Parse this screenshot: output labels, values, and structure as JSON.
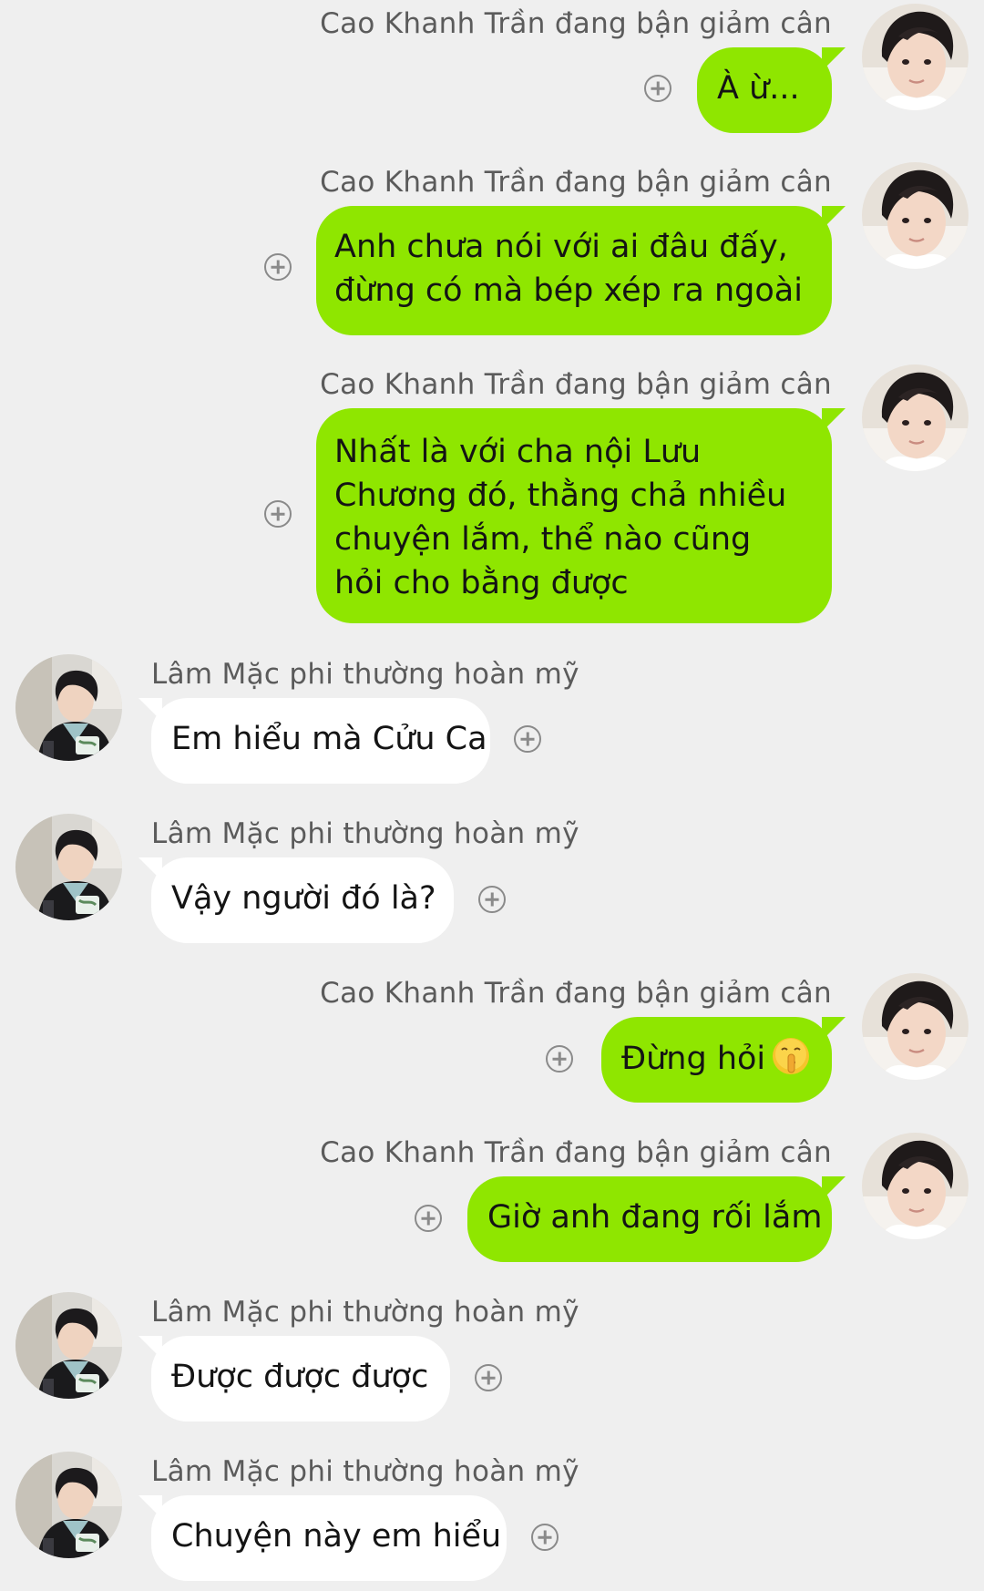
{
  "colors": {
    "background": "#efefef",
    "outgoing_bubble": "#8fe600",
    "incoming_bubble": "#ffffff",
    "name_text": "#5b5b5b",
    "plus_icon": "#8a8a8a"
  },
  "contacts": {
    "me_name": "Cao Khanh Trần đang bận giảm cân",
    "other_name": "Lâm Mặc phi thường hoàn mỹ"
  },
  "messages": [
    {
      "direction": "out",
      "text": "À ừ..."
    },
    {
      "direction": "out",
      "text": "Anh chưa nói với ai đâu đấy, đừng có mà bép xép ra ngoài"
    },
    {
      "direction": "out",
      "text": "Nhất là với cha nội Lưu Chương đó, thằng chả nhiều chuyện lắm, thể nào cũng hỏi cho bằng được"
    },
    {
      "direction": "in",
      "text": "Em hiểu mà Cửu Ca"
    },
    {
      "direction": "in",
      "text": "Vậy người đó là?"
    },
    {
      "direction": "out",
      "text": "Đừng hỏi",
      "emoji": "shushing-face-emoji"
    },
    {
      "direction": "out",
      "text": "Giờ anh đang rối lắm"
    },
    {
      "direction": "in",
      "text": "Được được được"
    },
    {
      "direction": "in",
      "text": "Chuyện này em hiểu"
    }
  ],
  "icons": {
    "add_reaction": "plus-circle-icon",
    "avatar_me": "avatar-cao-khanh",
    "avatar_other": "avatar-lam-mac"
  }
}
